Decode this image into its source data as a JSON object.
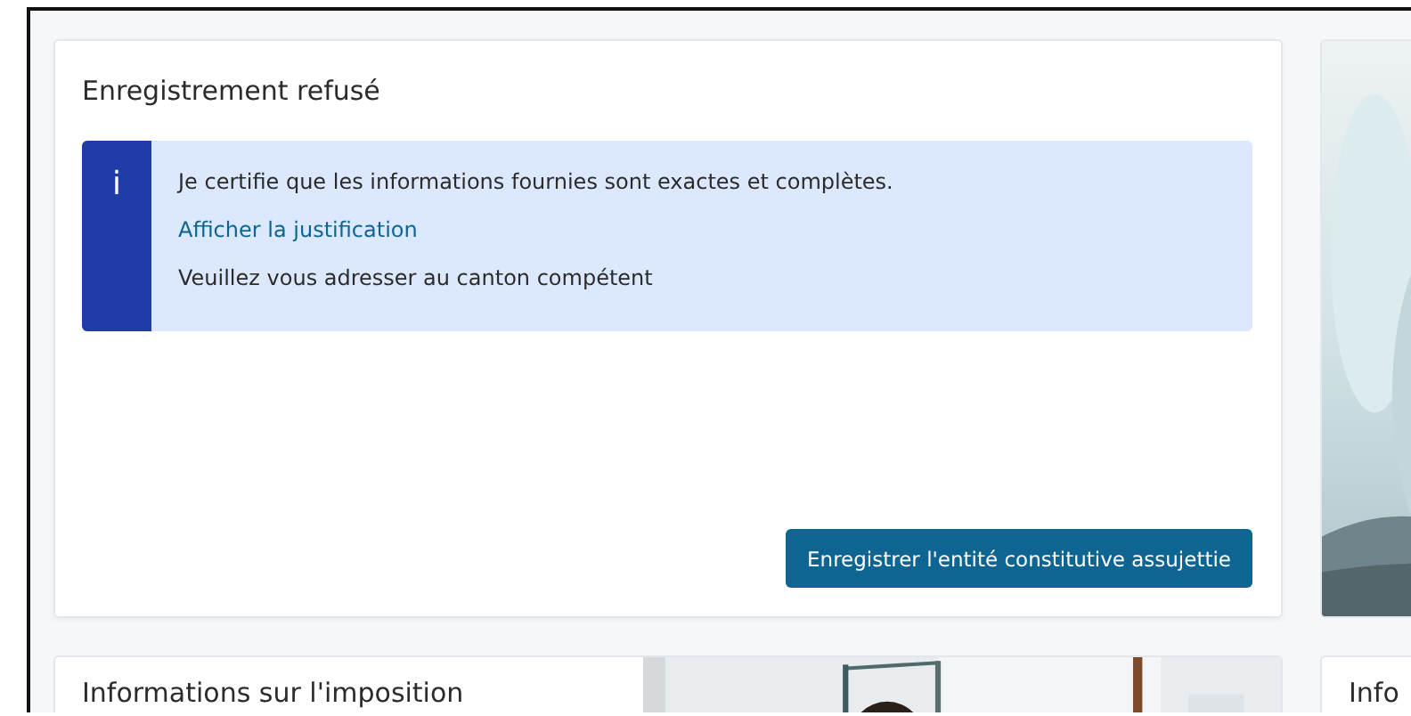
{
  "status_card": {
    "title": "Enregistrement refusé",
    "notice": {
      "icon": "i",
      "message": "Je certifie que les informations fournies sont exactes et complètes.",
      "link": "Afficher la justification",
      "note": "Veuillez vous adresser au canton compétent"
    },
    "button": "Enregistrer l'entité constitutive assujettie"
  },
  "tax_card": {
    "title": "Informations sur l'imposition"
  },
  "third_card": {
    "title": "Info"
  }
}
